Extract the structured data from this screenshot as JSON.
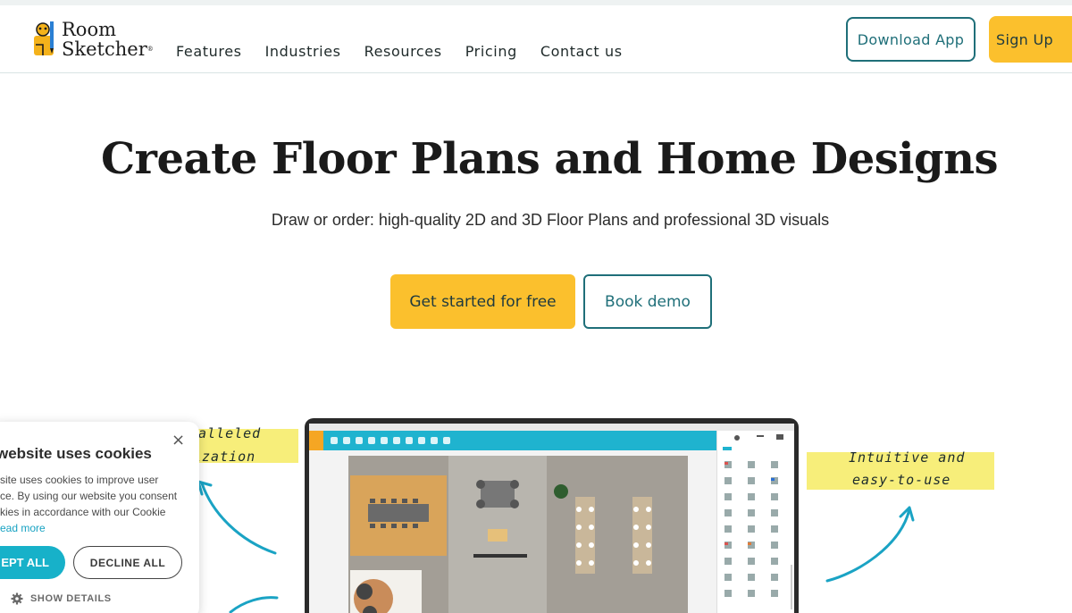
{
  "header": {
    "logo": {
      "line1": "Room",
      "line2": "Sketcher",
      "reg": "®"
    },
    "nav": [
      "Features",
      "Industries",
      "Resources",
      "Pricing",
      "Contact us"
    ],
    "download_label": "Download App",
    "signup_label": "Sign Up"
  },
  "hero": {
    "title": "Create Floor Plans and Home Designs",
    "subtitle": "Draw or order: high-quality 2D and 3D Floor Plans and professional 3D visuals",
    "cta_primary": "Get started for free",
    "cta_secondary": "Book demo"
  },
  "annotations": {
    "left_line1": "alleled",
    "left_line2": "ization",
    "right_line1": "Intuitive and",
    "right_line2": "easy-to-use"
  },
  "cookie": {
    "title": "website uses cookies",
    "body_lines": [
      "site uses cookies to improve user",
      "ce. By using our website you consent",
      "kies in accordance with our Cookie"
    ],
    "read_more": "ead more",
    "accept_label": "EPT ALL",
    "decline_label": "DECLINE ALL",
    "details_label": "SHOW DETAILS",
    "close_symbol": "×"
  },
  "colors": {
    "brand_yellow": "#fbc02d",
    "brand_teal": "#1f6f79",
    "cookie_accept": "#17b1c9",
    "app_toolbar": "#1fb3cf",
    "highlight": "#f7ee7a",
    "arrow": "#1aa3c4"
  }
}
